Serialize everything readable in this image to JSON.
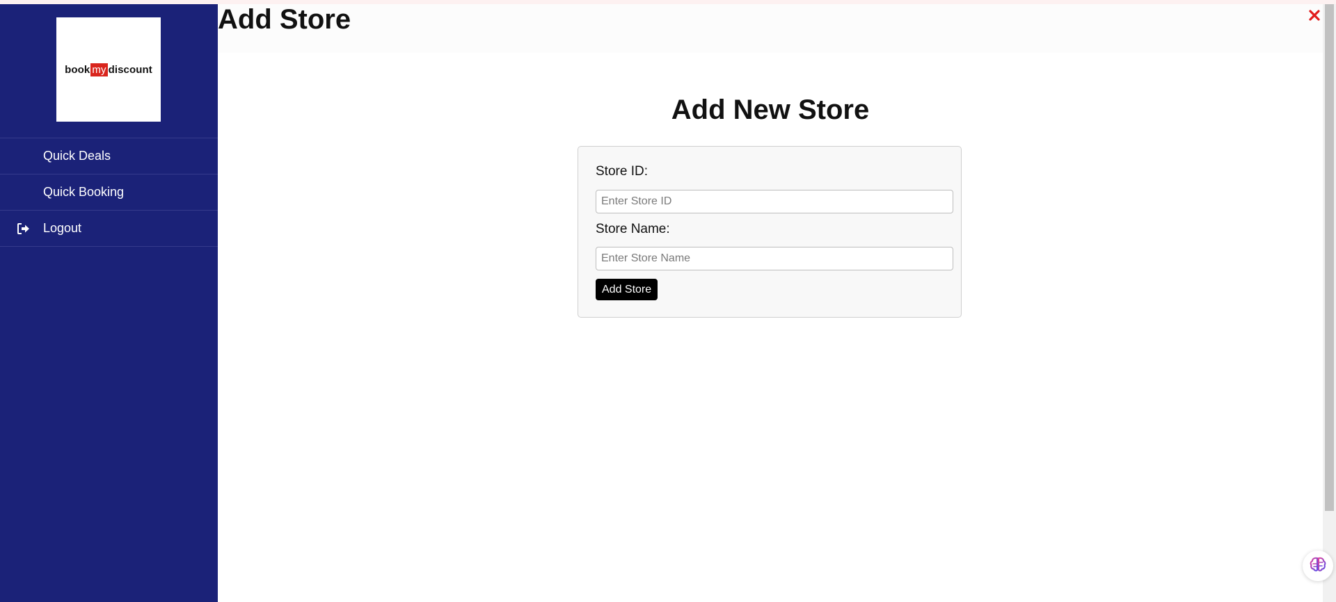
{
  "app": {
    "brand": {
      "logo_text_before": "book",
      "logo_text_highlight": "my",
      "logo_text_after": "discount",
      "accent_color": "#d9251d",
      "sidebar_color": "#1b2278"
    }
  },
  "sidebar": {
    "items": [
      {
        "label": "Quick Deals",
        "icon": ""
      },
      {
        "label": "Quick Booking",
        "icon": ""
      },
      {
        "label": "Logout",
        "icon": "logout-icon"
      }
    ]
  },
  "header": {
    "title": "Add Store",
    "close_icon": "close-icon",
    "close_color": "#e21b1b"
  },
  "main": {
    "title": "Add New Store",
    "form": {
      "store_id": {
        "label": "Store ID:",
        "value": "",
        "placeholder": "Enter Store ID"
      },
      "store_name": {
        "label": "Store Name:",
        "value": "",
        "placeholder": "Enter Store Name"
      },
      "submit_label": "Add Store"
    }
  },
  "floating": {
    "assistant_icon": "brain-icon"
  }
}
